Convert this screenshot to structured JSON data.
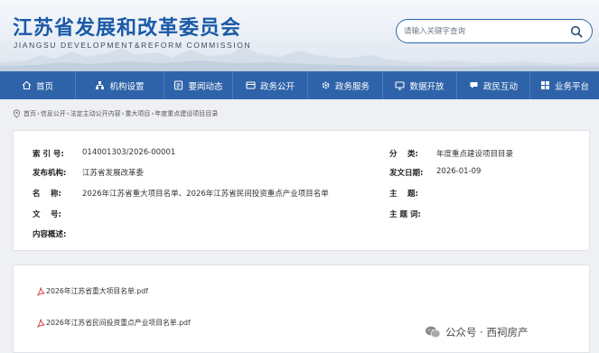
{
  "header": {
    "title": "江苏省发展和改革委员会",
    "subtitle": "JIANGSU DEVELOPMENT&REFORM COMMISSION",
    "search_placeholder": "请输入关键字查询"
  },
  "nav": {
    "items": [
      {
        "label": "首页",
        "icon": "home-icon"
      },
      {
        "label": "机构设置",
        "icon": "org-icon"
      },
      {
        "label": "要闻动态",
        "icon": "news-icon"
      },
      {
        "label": "政务公开",
        "icon": "gov-icon"
      },
      {
        "label": "政务服务",
        "icon": "service-icon"
      },
      {
        "label": "数据开放",
        "icon": "data-icon"
      },
      {
        "label": "政民互动",
        "icon": "interact-icon"
      },
      {
        "label": "业务平台",
        "icon": "platform-icon"
      }
    ]
  },
  "breadcrumb": [
    "首页",
    "信息公开",
    "法定主动公开内容",
    "重大项目",
    "年度重点建设项目目录"
  ],
  "info": {
    "index_label": "索 引 号:",
    "index_value": "014001303/2026-00001",
    "category_label": "分　 类:",
    "category_value": "年度重点建设项目目录",
    "issuer_label": "发布机构:",
    "issuer_value": "江苏省发展改革委",
    "date_label": "发文日期:",
    "date_value": "2026-01-09",
    "name_label": "名　 称:",
    "name_value": "2026年江苏省重大项目名单、2026年江苏省民间投资重点产业项目名单",
    "subject_label": "主　 题:",
    "subject_value": "",
    "docno_label": "文　 号:",
    "docno_value": "",
    "keywords_label": "主 题 词:",
    "keywords_value": "",
    "summary_label": "内容概述:",
    "summary_value": ""
  },
  "attachments": [
    {
      "name": "2026年江苏省重大项目名单.pdf"
    },
    {
      "name": "2026年江苏省民间投资重点产业项目名单.pdf"
    }
  ],
  "watermark": {
    "text": "公众号 · 西祠房产"
  },
  "colors": {
    "brand": "#1b5aa8",
    "nav_bg": "#2f63a9",
    "pdf_red": "#d7332c"
  }
}
